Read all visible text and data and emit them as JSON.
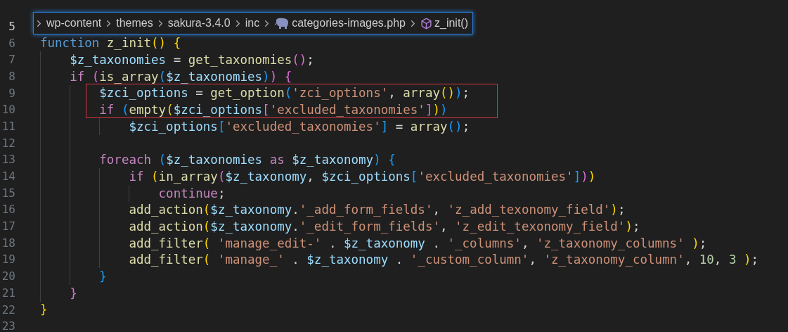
{
  "breadcrumb": [
    {
      "kind": "folder",
      "label": "wp-content"
    },
    {
      "kind": "folder",
      "label": "themes"
    },
    {
      "kind": "folder",
      "label": "sakura-3.4.0"
    },
    {
      "kind": "folder",
      "label": "inc"
    },
    {
      "kind": "php-file",
      "label": "categories-images.php"
    },
    {
      "kind": "function",
      "label": "z_init()"
    }
  ],
  "lines": [
    {
      "number": "5",
      "active": true,
      "boxed": false
    },
    {
      "number": "6",
      "active": false,
      "boxed": false,
      "tokens": [
        {
          "text": "function",
          "color": "#569cd6"
        },
        {
          "text": " z_init",
          "color": "#dcdcaa"
        },
        {
          "text": "(",
          "color": "#ffd700"
        },
        {
          "text": ")",
          "color": "#ffd700"
        },
        {
          "text": " {",
          "color": "#ffd700"
        }
      ]
    },
    {
      "number": "7",
      "active": false,
      "boxed": false,
      "tokens": [
        {
          "text": "    $z_taxonomies",
          "color": "#9cdcfe"
        },
        {
          "text": " = "
        },
        {
          "text": "get_taxonomies",
          "color": "#dcdcaa"
        },
        {
          "text": "(",
          "color": "#da70d6"
        },
        {
          "text": ")",
          "color": "#da70d6"
        },
        {
          "text": ";"
        }
      ]
    },
    {
      "number": "8",
      "active": false,
      "boxed": false,
      "tokens": [
        {
          "text": "    if",
          "color": "#c586c0"
        },
        {
          "text": " (",
          "color": "#da70d6"
        },
        {
          "text": "is_array",
          "color": "#dcdcaa"
        },
        {
          "text": "(",
          "color": "#179fff"
        },
        {
          "text": "$z_taxonomies",
          "color": "#9cdcfe"
        },
        {
          "text": ")",
          "color": "#179fff"
        },
        {
          "text": ")",
          "color": "#da70d6"
        },
        {
          "text": " {",
          "color": "#da70d6"
        }
      ]
    },
    {
      "number": "9",
      "active": false,
      "boxed": true,
      "tokens": [
        {
          "text": "        $zci_options",
          "color": "#9cdcfe"
        },
        {
          "text": " = "
        },
        {
          "text": "get_option",
          "color": "#dcdcaa"
        },
        {
          "text": "(",
          "color": "#179fff"
        },
        {
          "text": "'zci_options'",
          "color": "#ce9178"
        },
        {
          "text": ", "
        },
        {
          "text": "array",
          "color": "#dcdcaa"
        },
        {
          "text": "(",
          "color": "#ffd700"
        },
        {
          "text": ")",
          "color": "#ffd700"
        },
        {
          "text": ")",
          "color": "#179fff"
        },
        {
          "text": ";"
        }
      ]
    },
    {
      "number": "10",
      "active": false,
      "boxed": true,
      "tokens": [
        {
          "text": "        if",
          "color": "#c586c0"
        },
        {
          "text": " (",
          "color": "#179fff"
        },
        {
          "text": "empty",
          "color": "#dcdcaa"
        },
        {
          "text": "(",
          "color": "#ffd700"
        },
        {
          "text": "$zci_options",
          "color": "#9cdcfe"
        },
        {
          "text": "[",
          "color": "#da70d6"
        },
        {
          "text": "'excluded_taxonomies'",
          "color": "#ce9178"
        },
        {
          "text": "]",
          "color": "#da70d6"
        },
        {
          "text": ")",
          "color": "#ffd700"
        },
        {
          "text": ")",
          "color": "#179fff"
        }
      ]
    },
    {
      "number": "11",
      "active": false,
      "boxed": false,
      "tokens": [
        {
          "text": "            $zci_options",
          "color": "#9cdcfe"
        },
        {
          "text": "[",
          "color": "#179fff"
        },
        {
          "text": "'excluded_taxonomies'",
          "color": "#ce9178"
        },
        {
          "text": "]",
          "color": "#179fff"
        },
        {
          "text": " = "
        },
        {
          "text": "array",
          "color": "#dcdcaa"
        },
        {
          "text": "(",
          "color": "#179fff"
        },
        {
          "text": ")",
          "color": "#179fff"
        },
        {
          "text": ";"
        }
      ]
    },
    {
      "number": "12",
      "active": false,
      "boxed": false
    },
    {
      "number": "13",
      "active": false,
      "boxed": false,
      "tokens": [
        {
          "text": "        foreach",
          "color": "#c586c0"
        },
        {
          "text": " (",
          "color": "#179fff"
        },
        {
          "text": "$z_taxonomies",
          "color": "#9cdcfe"
        },
        {
          "text": " as",
          "color": "#c586c0"
        },
        {
          "text": " $z_taxonomy",
          "color": "#9cdcfe"
        },
        {
          "text": ")",
          "color": "#179fff"
        },
        {
          "text": " {",
          "color": "#179fff"
        }
      ]
    },
    {
      "number": "14",
      "active": false,
      "boxed": false,
      "tokens": [
        {
          "text": "            if",
          "color": "#c586c0"
        },
        {
          "text": " (",
          "color": "#ffd700"
        },
        {
          "text": "in_array",
          "color": "#dcdcaa"
        },
        {
          "text": "(",
          "color": "#da70d6"
        },
        {
          "text": "$z_taxonomy",
          "color": "#9cdcfe"
        },
        {
          "text": ", "
        },
        {
          "text": "$zci_options",
          "color": "#9cdcfe"
        },
        {
          "text": "[",
          "color": "#179fff"
        },
        {
          "text": "'excluded_taxonomies'",
          "color": "#ce9178"
        },
        {
          "text": "]",
          "color": "#179fff"
        },
        {
          "text": ")",
          "color": "#da70d6"
        },
        {
          "text": ")",
          "color": "#ffd700"
        }
      ]
    },
    {
      "number": "15",
      "active": false,
      "boxed": false,
      "tokens": [
        {
          "text": "                continue",
          "color": "#c586c0"
        },
        {
          "text": ";"
        }
      ]
    },
    {
      "number": "16",
      "active": false,
      "boxed": false,
      "tokens": [
        {
          "text": "            add_action",
          "color": "#dcdcaa"
        },
        {
          "text": "(",
          "color": "#ffd700"
        },
        {
          "text": "$z_taxonomy",
          "color": "#9cdcfe"
        },
        {
          "text": "."
        },
        {
          "text": "'_add_form_fields'",
          "color": "#ce9178"
        },
        {
          "text": ", "
        },
        {
          "text": "'z_add_texonomy_field'",
          "color": "#ce9178"
        },
        {
          "text": ")",
          "color": "#ffd700"
        },
        {
          "text": ";"
        }
      ]
    },
    {
      "number": "17",
      "active": false,
      "boxed": false,
      "tokens": [
        {
          "text": "            add_action",
          "color": "#dcdcaa"
        },
        {
          "text": "(",
          "color": "#ffd700"
        },
        {
          "text": "$z_taxonomy",
          "color": "#9cdcfe"
        },
        {
          "text": "."
        },
        {
          "text": "'_edit_form_fields'",
          "color": "#ce9178"
        },
        {
          "text": ", "
        },
        {
          "text": "'z_edit_texonomy_field'",
          "color": "#ce9178"
        },
        {
          "text": ")",
          "color": "#ffd700"
        },
        {
          "text": ";"
        }
      ]
    },
    {
      "number": "18",
      "active": false,
      "boxed": false,
      "tokens": [
        {
          "text": "            add_filter",
          "color": "#dcdcaa"
        },
        {
          "text": "(",
          "color": "#ffd700"
        },
        {
          "text": " 'manage_edit-'",
          "color": "#ce9178"
        },
        {
          "text": " . "
        },
        {
          "text": "$z_taxonomy",
          "color": "#9cdcfe"
        },
        {
          "text": " . "
        },
        {
          "text": "'_columns'",
          "color": "#ce9178"
        },
        {
          "text": ", "
        },
        {
          "text": "'z_taxonomy_columns'",
          "color": "#ce9178"
        },
        {
          "text": " )",
          "color": "#ffd700"
        },
        {
          "text": ";"
        }
      ]
    },
    {
      "number": "19",
      "active": false,
      "boxed": false,
      "tokens": [
        {
          "text": "            add_filter",
          "color": "#dcdcaa"
        },
        {
          "text": "(",
          "color": "#ffd700"
        },
        {
          "text": " 'manage_'",
          "color": "#ce9178"
        },
        {
          "text": " . "
        },
        {
          "text": "$z_taxonomy",
          "color": "#9cdcfe"
        },
        {
          "text": " . "
        },
        {
          "text": "'_custom_column'",
          "color": "#ce9178"
        },
        {
          "text": ", "
        },
        {
          "text": "'z_taxonomy_column'",
          "color": "#ce9178"
        },
        {
          "text": ", "
        },
        {
          "text": "10",
          "color": "#b5cea8"
        },
        {
          "text": ", "
        },
        {
          "text": "3",
          "color": "#b5cea8"
        },
        {
          "text": " )",
          "color": "#ffd700"
        },
        {
          "text": ";"
        }
      ]
    },
    {
      "number": "20",
      "active": false,
      "boxed": false,
      "tokens": [
        {
          "text": "        }",
          "color": "#179fff"
        }
      ]
    },
    {
      "number": "21",
      "active": false,
      "boxed": false,
      "tokens": [
        {
          "text": "    }",
          "color": "#da70d6"
        }
      ]
    },
    {
      "number": "22",
      "active": false,
      "boxed": false,
      "tokens": [
        {
          "text": "}",
          "color": "#ffd700"
        }
      ]
    },
    {
      "number": "23",
      "active": false,
      "boxed": false
    }
  ]
}
